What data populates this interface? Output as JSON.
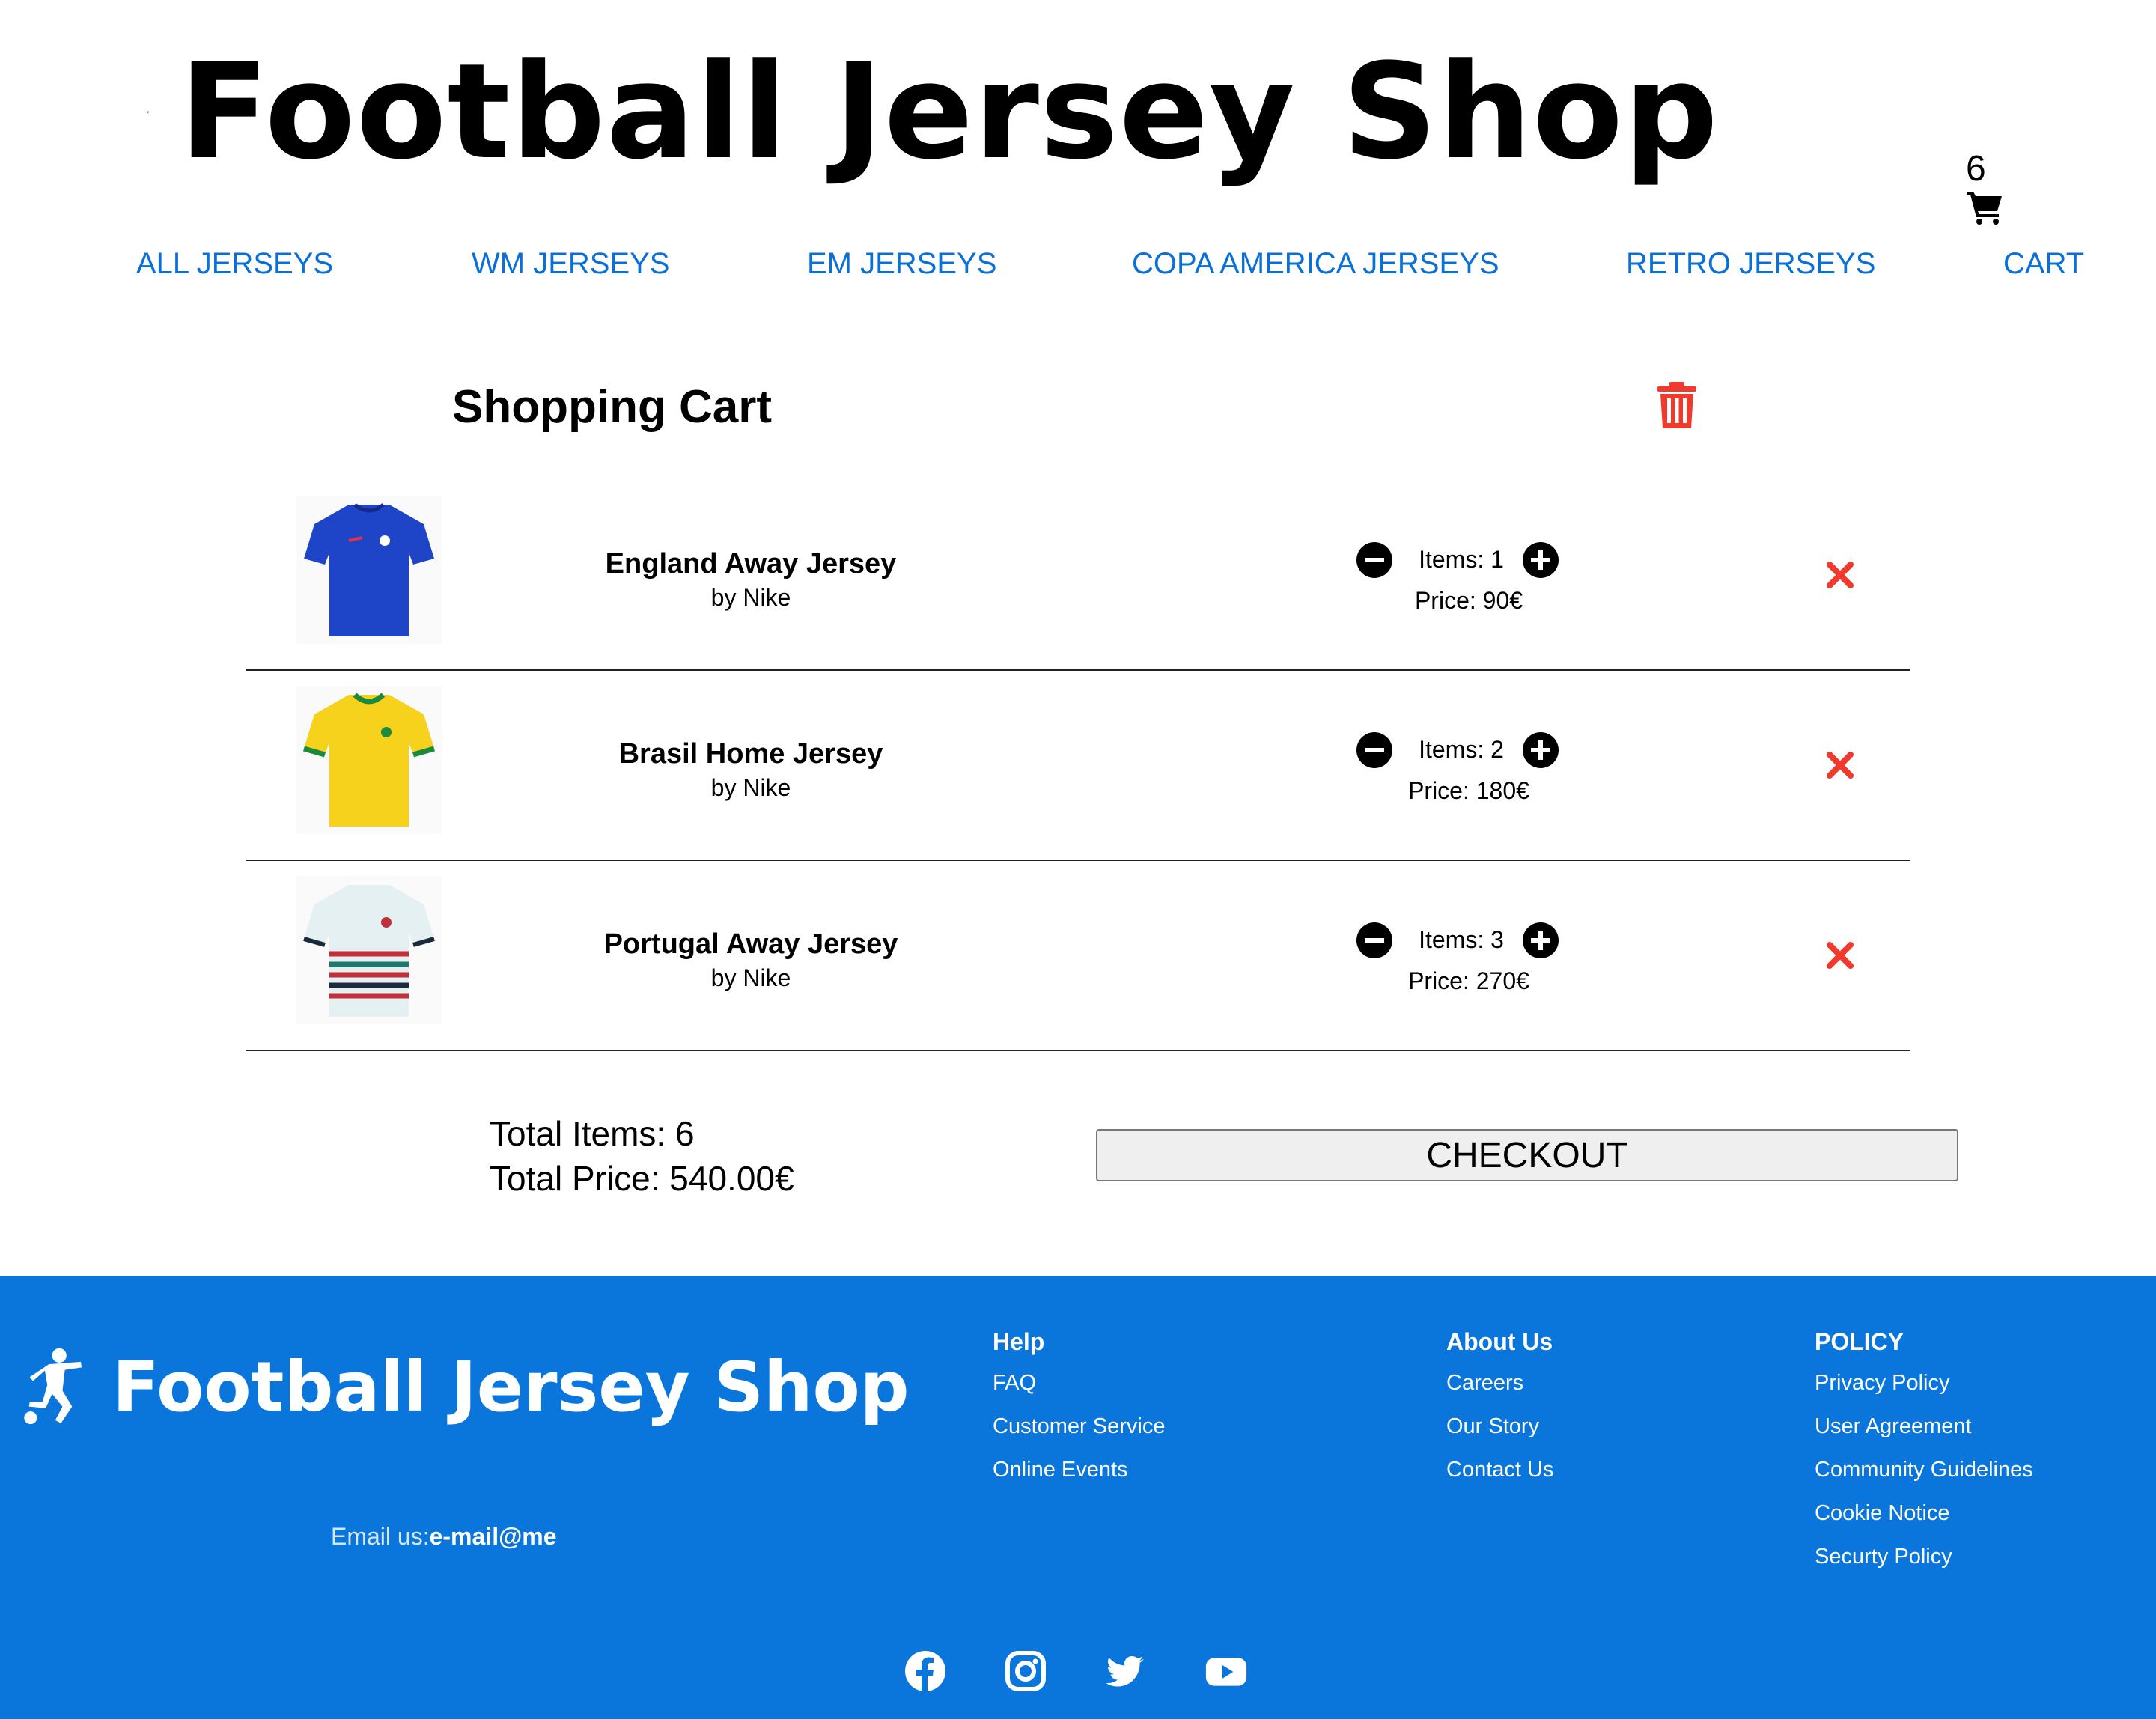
{
  "brand": {
    "name": "Football Jersey Shop",
    "logo_icon": "football-player-icon",
    "logo_color": "#1a3ef0"
  },
  "cart_count": "6",
  "nav": [
    {
      "label": "ALL JERSEYS"
    },
    {
      "label": "WM JERSEYS"
    },
    {
      "label": "EM JERSEYS"
    },
    {
      "label": "COPA AMERICA JERSEYS"
    },
    {
      "label": "RETRO JERSEYS"
    },
    {
      "label": "CART"
    }
  ],
  "cart": {
    "title": "Shopping Cart",
    "items": [
      {
        "name": "England Away Jersey",
        "brand": "by Nike",
        "items": "Items: 1",
        "price": "Price: 90€"
      },
      {
        "name": "Brasil Home Jersey",
        "brand": "by Nike",
        "items": "Items: 2",
        "price": "Price: 180€"
      },
      {
        "name": "Portugal Away Jersey",
        "brand": "by Nike",
        "items": "Items: 3",
        "price": "Price: 270€"
      }
    ],
    "total_items": "Total Items: 6",
    "total_price": "Total Price: 540.00€",
    "checkout_label": "CHECKOUT"
  },
  "footer": {
    "email_label": "Email us:",
    "email": "e-mail@me",
    "columns": [
      {
        "title": "Help",
        "links": [
          "FAQ",
          "Customer Service",
          "Online Events"
        ]
      },
      {
        "title": "About Us",
        "links": [
          "Careers",
          "Our Story",
          "Contact Us"
        ]
      },
      {
        "title": "POLICY",
        "links": [
          "Privacy Policy",
          "User Agreement",
          "Community Guidelines",
          "Cookie Notice",
          "Securty Policy"
        ]
      }
    ],
    "socials": [
      "facebook-icon",
      "instagram-icon",
      "twitter-icon",
      "youtube-icon"
    ]
  },
  "colors": {
    "accent": "#0a76dc",
    "nav_link": "#0a6fd6",
    "danger": "#f03a2e"
  }
}
